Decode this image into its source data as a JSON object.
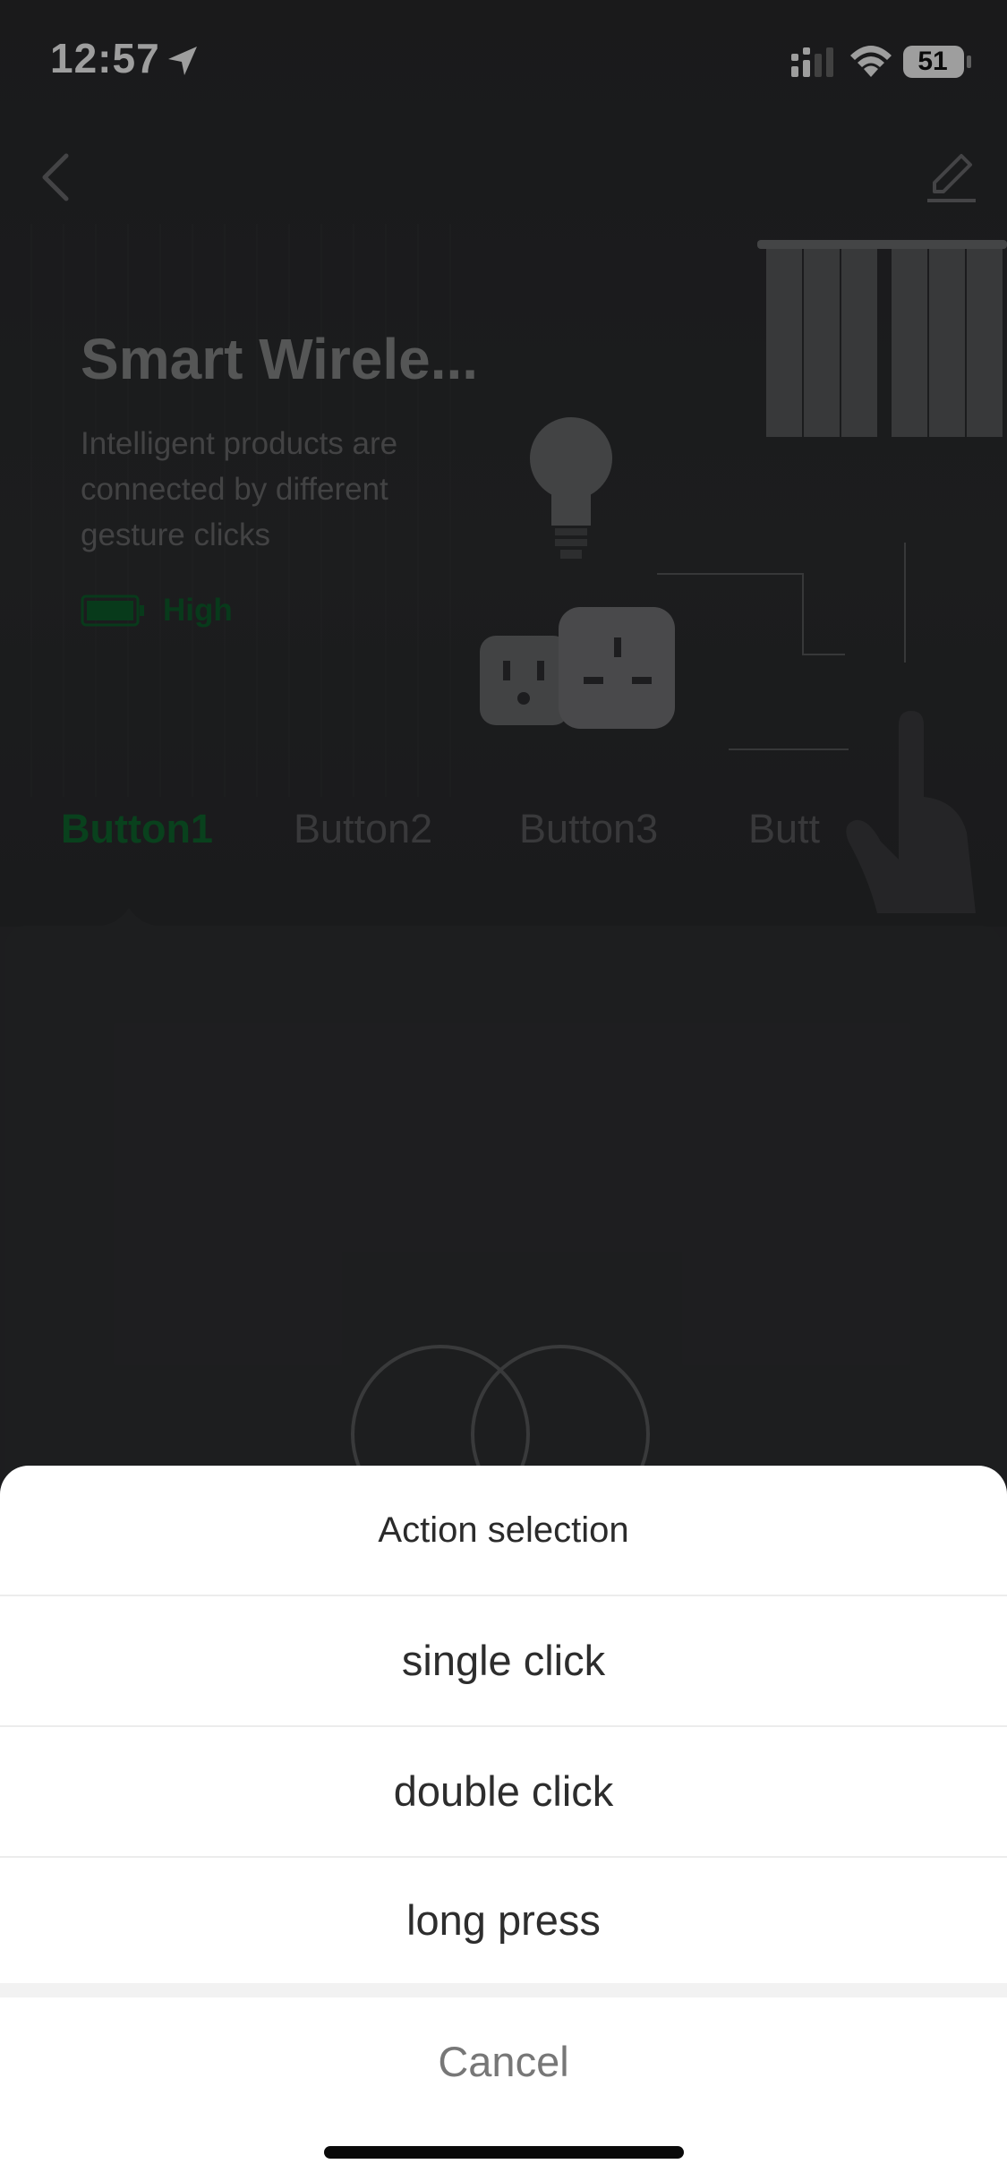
{
  "status_bar": {
    "time": "12:57",
    "battery_level": "51"
  },
  "device": {
    "title": "Smart Wirele...",
    "description": "Intelligent products are connected by different gesture clicks",
    "battery_label": "High"
  },
  "tabs": [
    {
      "label": "Button1",
      "active": true
    },
    {
      "label": "Button2",
      "active": false
    },
    {
      "label": "Button3",
      "active": false
    },
    {
      "label": "Butt",
      "active": false
    }
  ],
  "action_sheet": {
    "title": "Action selection",
    "options": [
      {
        "label": "single click"
      },
      {
        "label": "double click"
      },
      {
        "label": "long press"
      }
    ],
    "cancel_label": "Cancel"
  },
  "colors": {
    "accent_green": "#0f6a30",
    "sheet_background": "#ffffff",
    "page_background": "#2f3032"
  }
}
